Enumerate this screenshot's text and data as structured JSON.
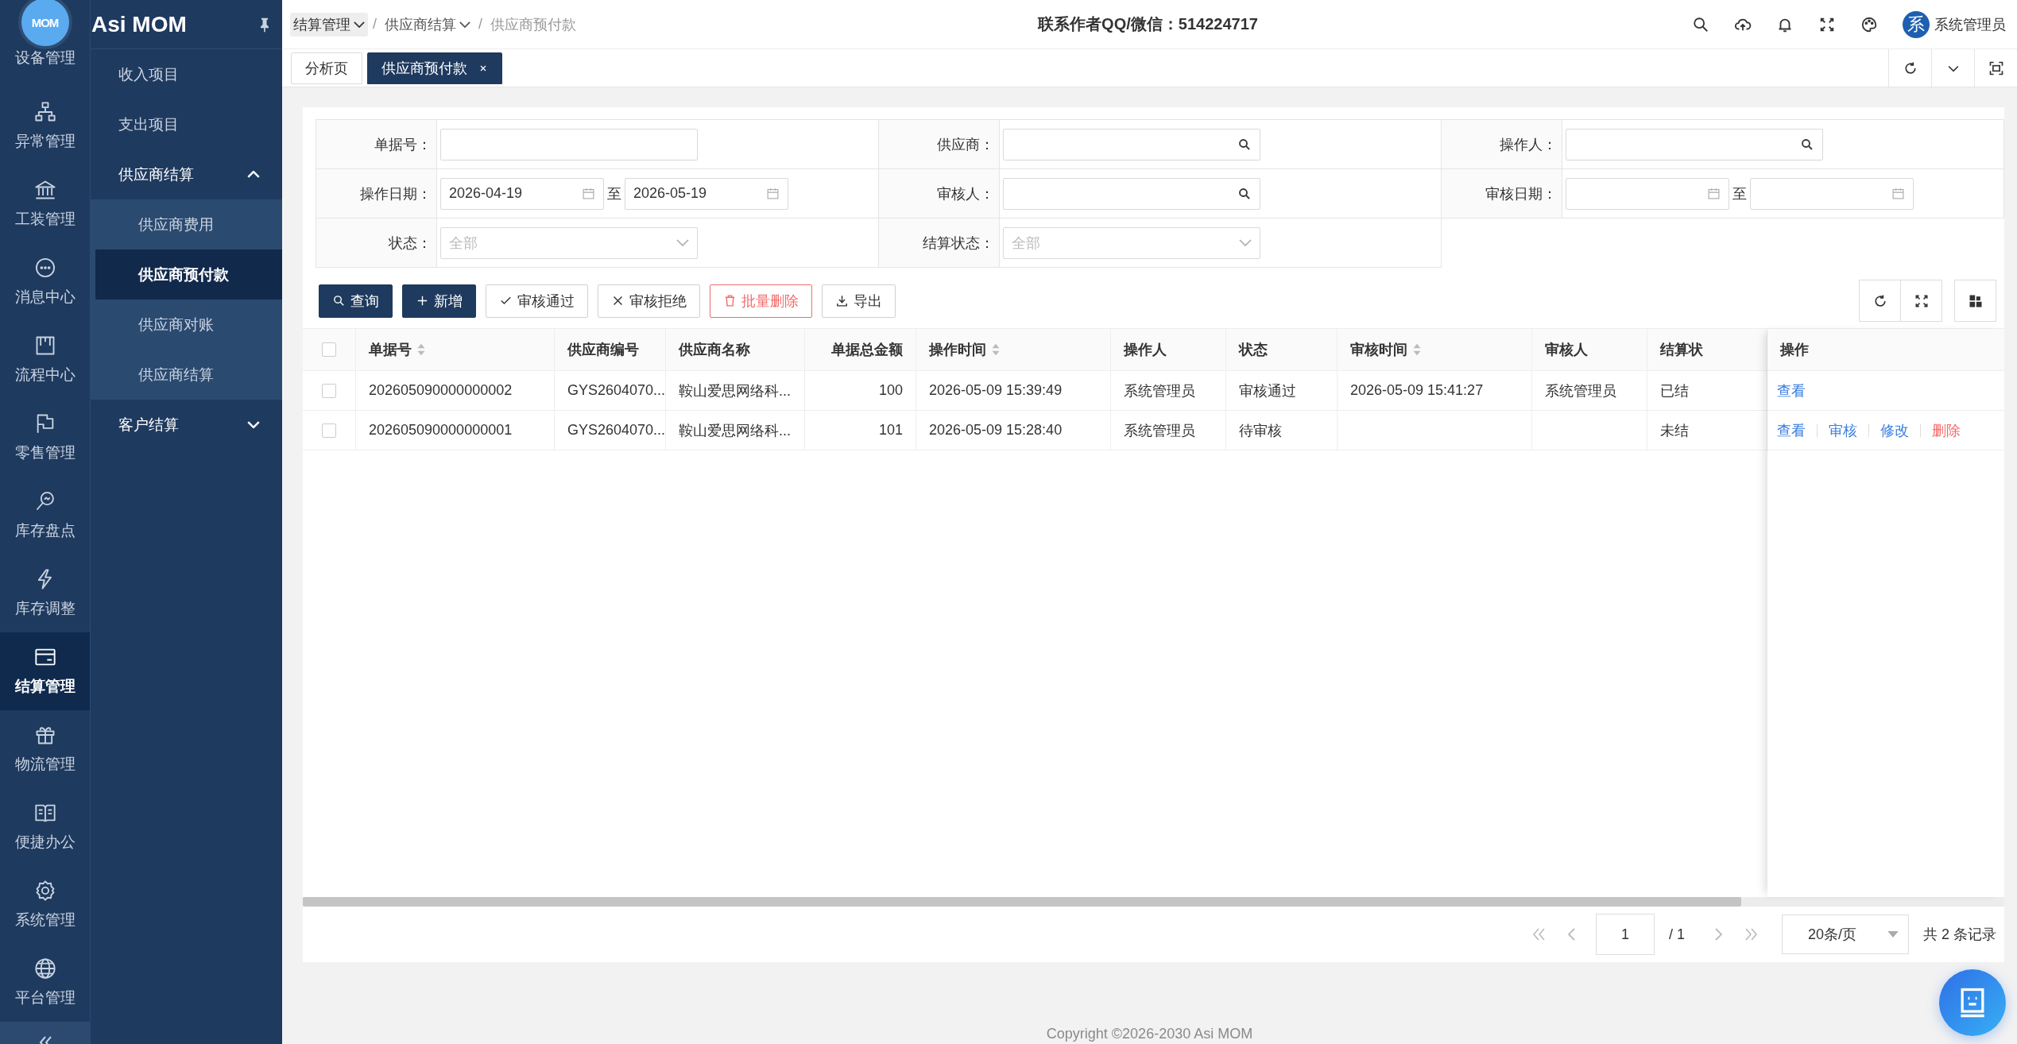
{
  "logo": {
    "text": "MOM"
  },
  "app_title": "Asi MOM",
  "rail": [
    {
      "label": "设备管理",
      "selected": false
    },
    {
      "label": "异常管理",
      "selected": false
    },
    {
      "label": "工装管理",
      "selected": false
    },
    {
      "label": "消息中心",
      "selected": false
    },
    {
      "label": "流程中心",
      "selected": false
    },
    {
      "label": "零售管理",
      "selected": false
    },
    {
      "label": "库存盘点",
      "selected": false
    },
    {
      "label": "库存调整",
      "selected": false
    },
    {
      "label": "结算管理",
      "selected": true
    },
    {
      "label": "物流管理",
      "selected": false
    },
    {
      "label": "便捷办公",
      "selected": false
    },
    {
      "label": "系统管理",
      "selected": false
    },
    {
      "label": "平台管理",
      "selected": false
    }
  ],
  "submenu": [
    {
      "label": "收入项目",
      "kind": "item",
      "selected": false
    },
    {
      "label": "支出项目",
      "kind": "item",
      "selected": false
    },
    {
      "label": "供应商结算",
      "kind": "group",
      "expanded": true,
      "children": [
        {
          "label": "供应商费用",
          "selected": false
        },
        {
          "label": "供应商预付款",
          "selected": true
        },
        {
          "label": "供应商对账",
          "selected": false
        },
        {
          "label": "供应商结算",
          "selected": false
        }
      ]
    },
    {
      "label": "客户结算",
      "kind": "group",
      "expanded": false
    }
  ],
  "breadcrumb": [
    {
      "label": "结算管理",
      "dropdown": true,
      "current": false
    },
    {
      "separator": "/",
      "label": "供应商结算",
      "dropdown": true,
      "current": false
    },
    {
      "separator": "/",
      "label": "供应商预付款",
      "dropdown": false,
      "current": true
    }
  ],
  "contact": "联系作者QQ/微信：514224717",
  "user": {
    "avatar": "系",
    "name": "系统管理员"
  },
  "tabs": [
    {
      "label": "分析页",
      "selected": false,
      "closable": false
    },
    {
      "label": "供应商预付款",
      "selected": true,
      "closable": true
    }
  ],
  "filters": [
    {
      "label": "单据号：",
      "kind": "text"
    },
    {
      "label": "供应商：",
      "kind": "lookup"
    },
    {
      "label": "操作人：",
      "kind": "lookup"
    },
    {
      "label": "操作日期：",
      "kind": "daterange",
      "from": "2026-04-19",
      "to": "2026-05-19",
      "separator": "至"
    },
    {
      "label": "审核人：",
      "kind": "lookup"
    },
    {
      "label": "审核日期：",
      "kind": "daterange",
      "separator": "至"
    },
    {
      "label": "状态：",
      "kind": "select",
      "placeholder": "全部"
    },
    {
      "label": "结算状态：",
      "kind": "select",
      "placeholder": "全部"
    }
  ],
  "toolbar": [
    {
      "label": "查询",
      "kind": "primary"
    },
    {
      "label": "新增",
      "kind": "primary"
    },
    {
      "label": "审核通过",
      "kind": "default"
    },
    {
      "label": "审核拒绝",
      "kind": "default"
    },
    {
      "label": "批量删除",
      "kind": "danger"
    },
    {
      "label": "导出",
      "kind": "default"
    }
  ],
  "table": {
    "header_checked": false,
    "columns": [
      {
        "label": "单据号",
        "sortable": true,
        "numeric": false
      },
      {
        "label": "供应商编号",
        "sortable": false,
        "numeric": false
      },
      {
        "label": "供应商名称",
        "sortable": false,
        "numeric": false
      },
      {
        "label": "单据总金额",
        "sortable": false,
        "numeric": true
      },
      {
        "label": "操作时间",
        "sortable": true,
        "numeric": false
      },
      {
        "label": "操作人",
        "sortable": false,
        "numeric": false
      },
      {
        "label": "状态",
        "sortable": false,
        "numeric": false
      },
      {
        "label": "审核时间",
        "sortable": true,
        "numeric": false
      },
      {
        "label": "审核人",
        "sortable": false,
        "numeric": false
      },
      {
        "label": "结算状",
        "sortable": false,
        "numeric": false
      }
    ],
    "actions_header": "操作",
    "rows": [
      {
        "checked": false,
        "cells": [
          "202605090000000002",
          "GYS2604070...",
          "鞍山爱思网络科...",
          "100",
          "2026-05-09 15:39:49",
          "系统管理员",
          "审核通过",
          "2026-05-09 15:41:27",
          "系统管理员",
          "已结"
        ],
        "actions": [
          {
            "label": "查看",
            "kind": "link"
          }
        ]
      },
      {
        "checked": false,
        "cells": [
          "202605090000000001",
          "GYS2604070...",
          "鞍山爱思网络科...",
          "101",
          "2026-05-09 15:28:40",
          "系统管理员",
          "待审核",
          "",
          "",
          "未结"
        ],
        "actions": [
          {
            "label": "查看",
            "kind": "link"
          },
          {
            "label": "审核",
            "kind": "link"
          },
          {
            "label": "修改",
            "kind": "link"
          },
          {
            "label": "删除",
            "kind": "danger"
          }
        ]
      }
    ]
  },
  "pagination": {
    "page": "1",
    "pages": "/ 1",
    "page_size": "20条/页",
    "total": "共 2 条记录"
  },
  "footer": "Copyright ©2026-2030 Asi MOM"
}
